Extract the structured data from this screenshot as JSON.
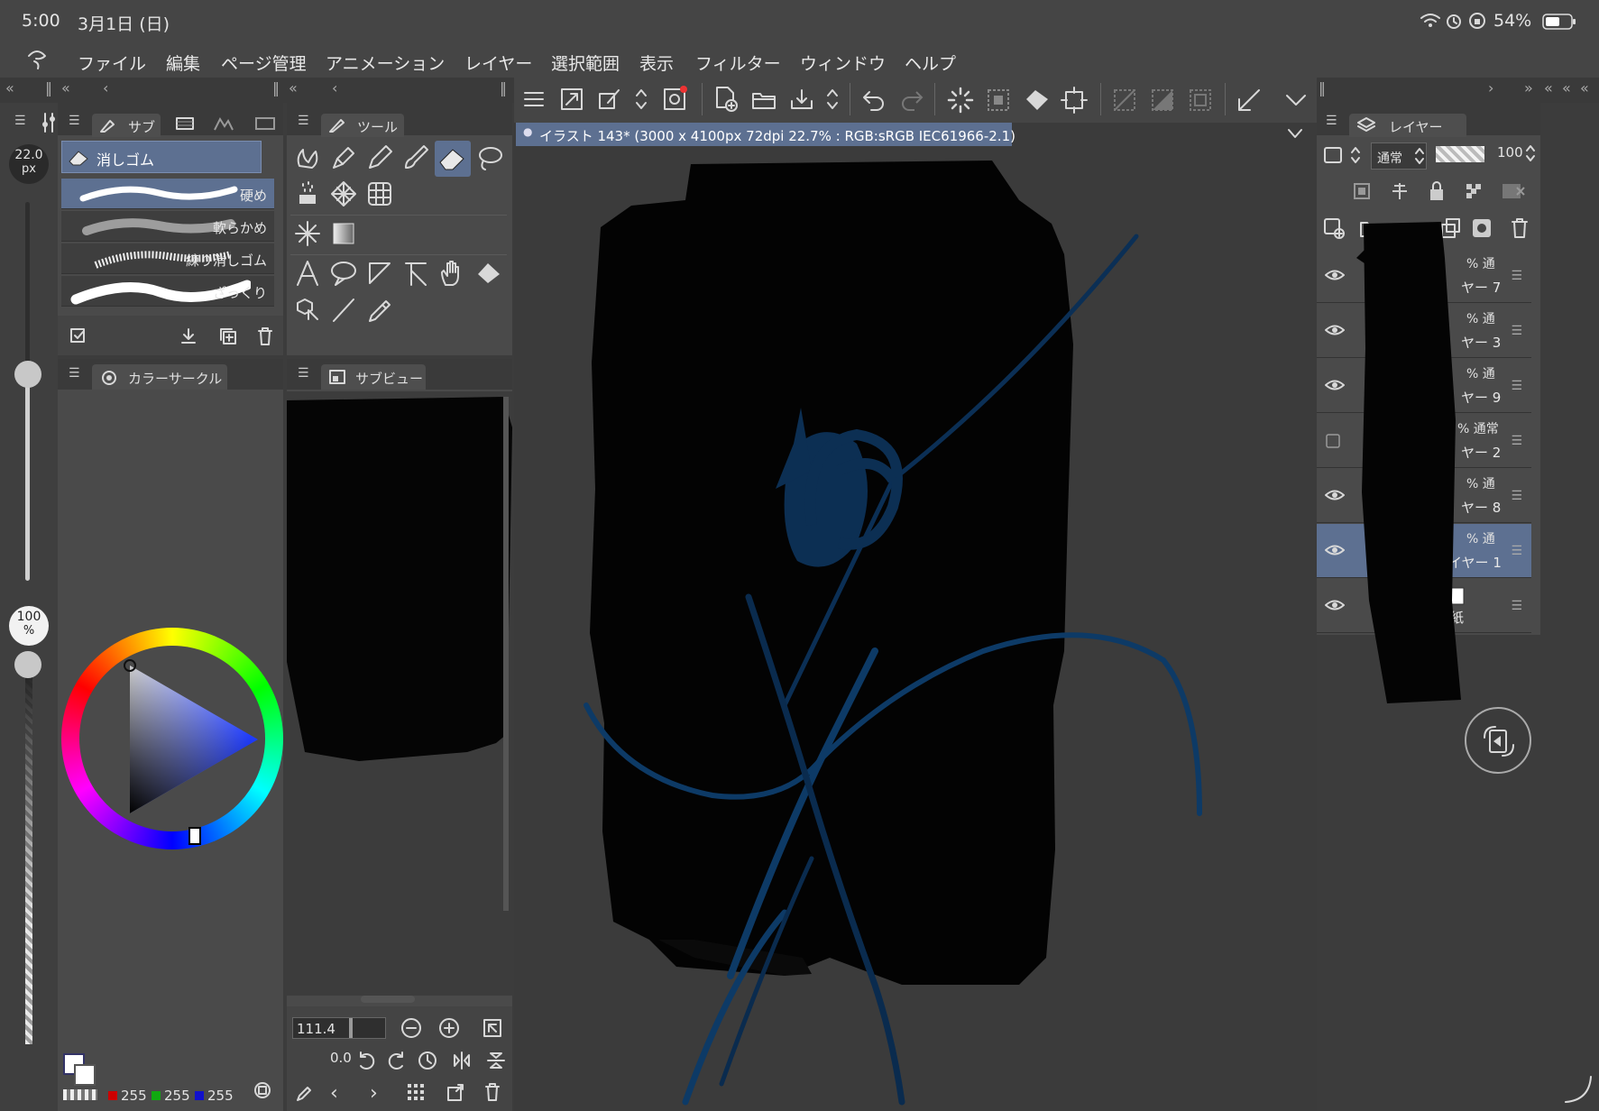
{
  "status": {
    "time": "5:00",
    "date": "3月1日 (日)",
    "battery": "54%"
  },
  "menu": [
    "ファイル",
    "編集",
    "ページ管理",
    "アニメーション",
    "レイヤー",
    "選択範囲",
    "表示",
    "フィルター",
    "ウィンドウ",
    "ヘルプ"
  ],
  "brush_size": {
    "value": "22.0",
    "unit": "px"
  },
  "opacity_side": {
    "value": "100",
    "unit": "%"
  },
  "sub_tool_panel": {
    "tab": "サブ",
    "selected_group": "消しゴム",
    "brushes": [
      "硬め",
      "軟らかめ",
      "練り消しゴム",
      "ざっくり"
    ]
  },
  "tool_panel": {
    "tab": "ツール"
  },
  "color_panel": {
    "tab": "カラーサークル",
    "rgb": {
      "r": "255",
      "g": "255",
      "b": "255"
    }
  },
  "subview_panel": {
    "tab": "サブビュー",
    "zoom": "111.4",
    "rotation": "0.0"
  },
  "canvas": {
    "title": "イラスト 143* (3000 x 4100px 72dpi 22.7% : RGB:sRGB IEC61966-2.1)"
  },
  "layer_panel": {
    "tab": "レイヤー",
    "blend_mode": "通常",
    "opacity": "100",
    "layers": [
      {
        "pct": "% 通",
        "name": "ヤー 7",
        "visible": true,
        "selected": false
      },
      {
        "pct": "% 通",
        "name": "ヤー 3",
        "visible": true,
        "selected": false
      },
      {
        "pct": "% 通",
        "name": "ヤー 9",
        "visible": true,
        "selected": false
      },
      {
        "pct": "% 通常",
        "name": "ヤー 2",
        "visible": false,
        "selected": false
      },
      {
        "pct": "% 通",
        "name": "ヤー 8",
        "visible": true,
        "selected": false
      },
      {
        "pct": "% 通",
        "name": "イヤー 1",
        "visible": true,
        "selected": true
      },
      {
        "pct": "",
        "name": "紙",
        "visible": true,
        "selected": false
      }
    ]
  },
  "colors": {
    "accent": "#5d7091",
    "canvas_bg": "#3b3b3b",
    "stroke_blue": "#0d3a66"
  }
}
